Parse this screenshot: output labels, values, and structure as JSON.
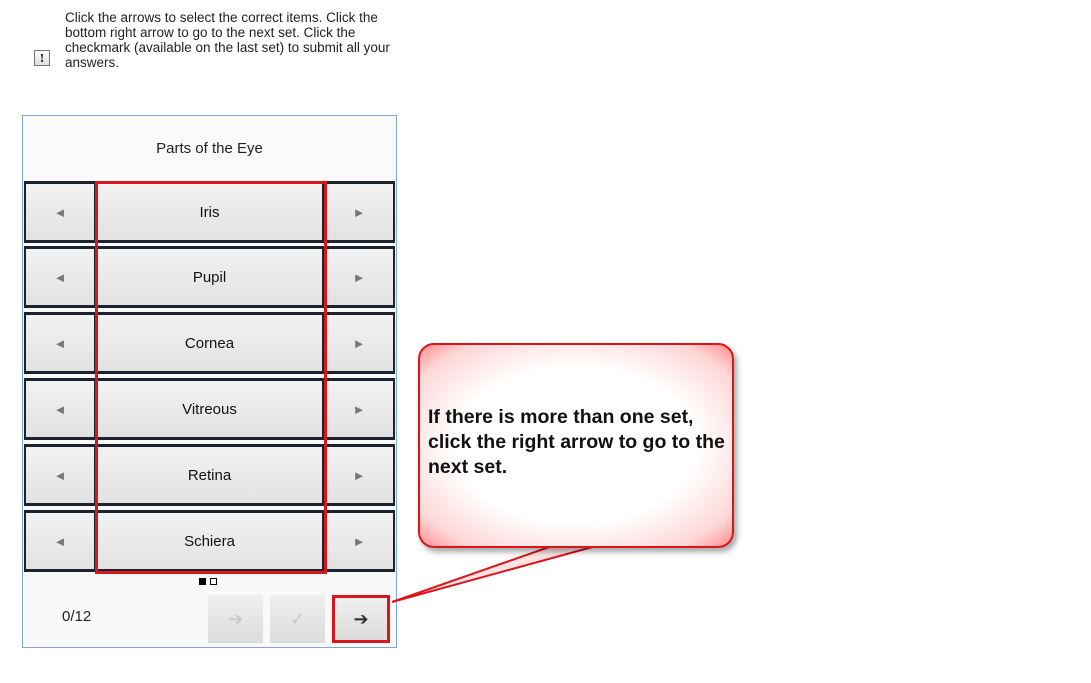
{
  "instructions": {
    "text": "Click the arrows to select the correct items. Click the bottom right arrow to go to the next set. Click the checkmark (available on the last set) to submit all your answers.",
    "icon": "info-icon"
  },
  "widget": {
    "title": "Parts of the Eye",
    "rows": [
      {
        "label": "Iris"
      },
      {
        "label": "Pupil"
      },
      {
        "label": "Cornea"
      },
      {
        "label": "Vitreous"
      },
      {
        "label": "Retina"
      },
      {
        "label": "Schiera"
      }
    ],
    "arrows": {
      "prev": "◄",
      "next": "►"
    },
    "pagination": {
      "total_sets": 2,
      "current_set": 1
    },
    "score": "0/12",
    "nav": {
      "prev_set_icon": "arrow-left-icon",
      "submit_icon": "checkmark-icon",
      "next_set_icon": "arrow-right-icon"
    }
  },
  "callout": {
    "text": "If there is more than one set, click the right arrow to go to the next set."
  },
  "colors": {
    "highlight": "#d9161c",
    "widget_border": "#7fa6d8"
  }
}
